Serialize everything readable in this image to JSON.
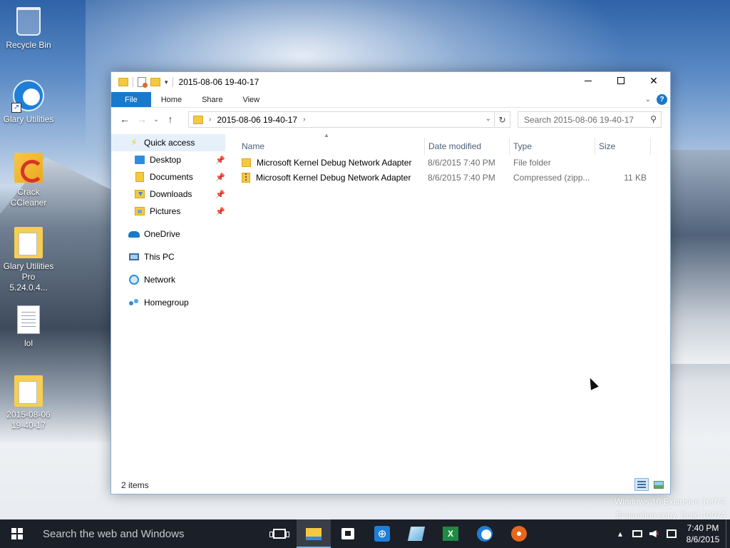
{
  "desktop": {
    "icons": [
      {
        "label": "Recycle Bin",
        "icon": "recycle-bin-icon"
      },
      {
        "label": "Glary Utilities",
        "icon": "glary-utilities-icon"
      },
      {
        "label": "Crack CCleaner",
        "icon": "ccleaner-icon"
      },
      {
        "label": "Glary Utilities Pro 5.24.0.4...",
        "icon": "zip-folder-icon"
      },
      {
        "label": "lol",
        "icon": "text-document-icon"
      },
      {
        "label": "2015-08-06 19-40-17",
        "icon": "zip-folder-icon"
      }
    ],
    "watermark": {
      "line1": "Windows 10 Exclusive 10074",
      "line2": "Evaluation copy. Build 10074"
    }
  },
  "window": {
    "title": "2015-08-06 19-40-17",
    "ribbon_tabs": [
      "File",
      "Home",
      "Share",
      "View"
    ],
    "help_label": "?",
    "address": {
      "crumb": "2015-08-06 19-40-17"
    },
    "search": {
      "placeholder": "Search 2015-08-06 19-40-17"
    },
    "navpane": {
      "quick_access": "Quick access",
      "pinned": [
        "Desktop",
        "Documents",
        "Downloads",
        "Pictures"
      ],
      "onedrive": "OneDrive",
      "this_pc": "This PC",
      "network": "Network",
      "homegroup": "Homegroup"
    },
    "columns": {
      "name": "Name",
      "date": "Date modified",
      "type": "Type",
      "size": "Size"
    },
    "files": [
      {
        "name": "Microsoft Kernel Debug Network Adapter",
        "date": "8/6/2015 7:40 PM",
        "type": "File folder",
        "size": "",
        "icon": "folder-icon"
      },
      {
        "name": "Microsoft Kernel Debug Network Adapter",
        "date": "8/6/2015 7:40 PM",
        "type": "Compressed (zipp...",
        "size": "11 KB",
        "icon": "zip-folder-icon"
      }
    ],
    "status": "2 items"
  },
  "taskbar": {
    "search_placeholder": "Search the web and Windows",
    "clock_time": "7:40 PM",
    "clock_date": "8/6/2015"
  },
  "colors": {
    "accent": "#1979ca",
    "taskbar": "#1b1f27"
  }
}
